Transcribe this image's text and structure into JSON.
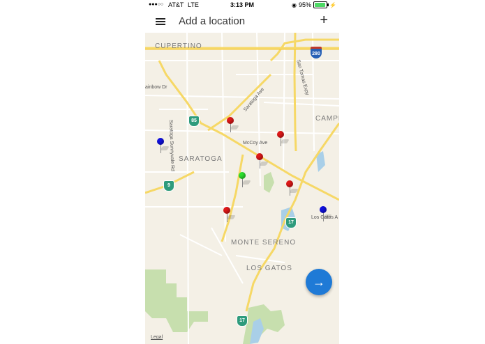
{
  "status_bar": {
    "signal": "●●●○○",
    "carrier": "AT&T",
    "network": "LTE",
    "time": "3:13 PM",
    "battery_text": "95%",
    "battery_level": 0.95
  },
  "header": {
    "menu_icon": "list-icon",
    "title": "Add a location",
    "add_icon": "plus-icon",
    "add_symbol": "+"
  },
  "map": {
    "labels": {
      "cupertino": "CUPERTINO",
      "saratoga": "SARATOGA",
      "campbell": "CAMPE",
      "monte_sereno": "MONTE SERENO",
      "los_gatos": "LOS GATOS",
      "saratoga_ave": "Saratoga Ave",
      "san_tomas": "San Tomas Expy",
      "rainbow": "ainbow Dr",
      "saratoga_sunnyvale": "Saratoga Sunnyvale Rd",
      "mccoy": "McCoy Ave",
      "los_gatos_ave": "Los Gatos A"
    },
    "shields": {
      "i280": "280",
      "ca85": "85",
      "ca9": "9",
      "ca17a": "17",
      "ca17b": "17"
    },
    "legal": "Legal",
    "pin_colors": {
      "red": "#e01818",
      "green": "#2ee02e",
      "blue": "#1010e0"
    }
  },
  "fab": {
    "icon": "arrow-right-icon",
    "symbol": "→",
    "color": "#1f7ad6"
  }
}
